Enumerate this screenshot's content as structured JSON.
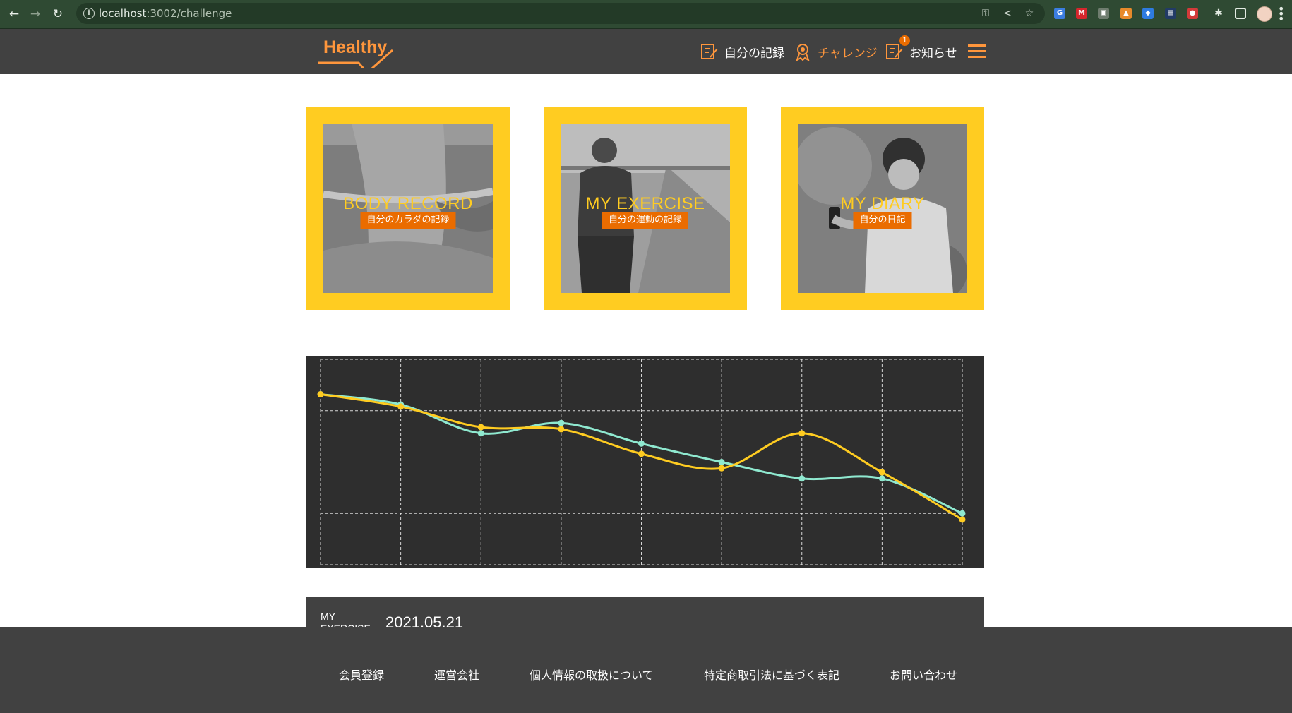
{
  "browser": {
    "url_host": "localhost",
    "url_rest": ":3002/challenge"
  },
  "header": {
    "logo_text": "Healthy",
    "nav": [
      {
        "label": "自分の記録",
        "icon": "memo-icon"
      },
      {
        "label": "チャレンジ",
        "icon": "medal-icon",
        "active": true
      },
      {
        "label": "お知らせ",
        "icon": "info-icon",
        "badge": "1"
      }
    ],
    "accent_color": "#ff963c",
    "badge_color": "#ea6c00"
  },
  "tiles": [
    {
      "title": "BODY RECORD",
      "label": "自分のカラダの記録"
    },
    {
      "title": "MY EXERCISE",
      "label": "自分の運動の記録"
    },
    {
      "title": "MY DIARY",
      "label": "自分の日記"
    }
  ],
  "chart_data": {
    "type": "line",
    "grid": true,
    "ylim": [
      0,
      100
    ],
    "series": [
      {
        "color": "#8fe9d0",
        "values": [
          83,
          78,
          64,
          69,
          59,
          50,
          42,
          42,
          25
        ]
      },
      {
        "color": "#ffcc21",
        "values": [
          83,
          77,
          67,
          66,
          54,
          47,
          64,
          45,
          22
        ]
      }
    ]
  },
  "exercise": {
    "label": "MY EXERCISE",
    "date": "2021.05.21"
  },
  "footer": {
    "links": [
      "会員登録",
      "運営会社",
      "個人情報の取扱について",
      "特定商取引法に基づく表記",
      "お問い合わせ"
    ]
  }
}
